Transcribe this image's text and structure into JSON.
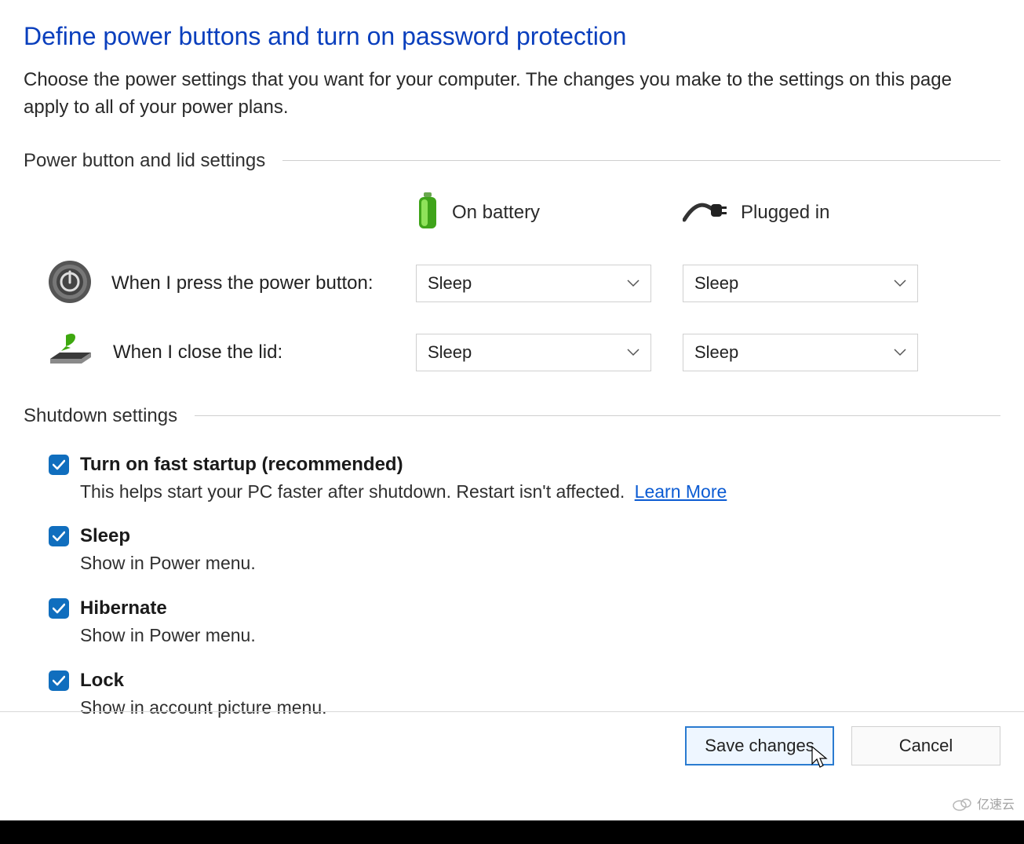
{
  "title": "Define power buttons and turn on password protection",
  "description": "Choose the power settings that you want for your computer. The changes you make to the settings on this page apply to all of your power plans.",
  "power_button_section": {
    "header": "Power button and lid settings",
    "columns": {
      "battery": "On battery",
      "plugged": "Plugged in"
    },
    "rows": {
      "power_button": {
        "label": "When I press the power button:",
        "battery_value": "Sleep",
        "plugged_value": "Sleep"
      },
      "close_lid": {
        "label": "When I close the lid:",
        "battery_value": "Sleep",
        "plugged_value": "Sleep"
      }
    }
  },
  "shutdown_section": {
    "header": "Shutdown settings",
    "items": {
      "fast_startup": {
        "checked": true,
        "title": "Turn on fast startup (recommended)",
        "desc": "This helps start your PC faster after shutdown. Restart isn't affected.",
        "learn_more": "Learn More"
      },
      "sleep": {
        "checked": true,
        "title": "Sleep",
        "desc": "Show in Power menu."
      },
      "hibernate": {
        "checked": true,
        "title": "Hibernate",
        "desc": "Show in Power menu."
      },
      "lock": {
        "checked": true,
        "title": "Lock",
        "desc": "Show in account picture menu."
      }
    }
  },
  "footer": {
    "save": "Save changes",
    "cancel": "Cancel"
  },
  "watermark": "亿速云"
}
